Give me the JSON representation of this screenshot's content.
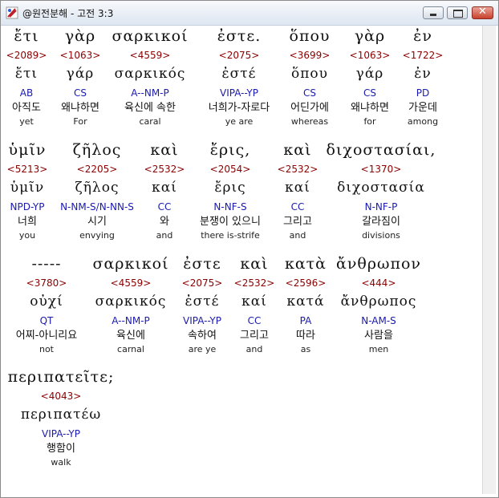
{
  "window": {
    "title": "@원전분해 - 고전 3:3",
    "minimize_label": "_",
    "maximize_label": "□",
    "close_label": "✕"
  },
  "rows": [
    {
      "words": [
        {
          "greek": "ἔτι",
          "strong": "<2089>",
          "lemma": "ἔτι",
          "code": "AB",
          "korean": "아직도",
          "english": "yet"
        },
        {
          "greek": "γὰρ",
          "strong": "<1063>",
          "lemma": "γάρ",
          "code": "CS",
          "korean": "왜냐하면",
          "english": "For"
        },
        {
          "greek": "σαρκικοί",
          "strong": "<4559>",
          "lemma": "σαρκικός",
          "code": "A--NM-P",
          "korean": "육신에 속한",
          "english": "caral"
        },
        {
          "greek": "ἐστε.",
          "strong": "<2075>",
          "lemma": "ἐστέ",
          "code": "VIPA--YP",
          "korean": "너희가-자로다",
          "english": "ye are"
        },
        {
          "greek": "ὅπου",
          "strong": "<3699>",
          "lemma": "ὅπου",
          "code": "CS",
          "korean": "어딘가에",
          "english": "whereas"
        },
        {
          "greek": "γὰρ",
          "strong": "<1063>",
          "lemma": "γάρ",
          "code": "CS",
          "korean": "왜냐하면",
          "english": "for"
        },
        {
          "greek": "ἐν",
          "strong": "<1722>",
          "lemma": "ἐν",
          "code": "PD",
          "korean": "가운데",
          "english": "among"
        }
      ]
    },
    {
      "words": [
        {
          "greek": "ὑμῖν",
          "strong": "<5213>",
          "lemma": "ὑμῖν",
          "code": "NPD-YP",
          "korean": "너희",
          "english": "you"
        },
        {
          "greek": "ζῆλος",
          "strong": "<2205>",
          "lemma": "ζῆλος",
          "code": "N-NM-S/N-NN-S",
          "korean": "시기",
          "english": "envying"
        },
        {
          "greek": "καὶ",
          "strong": "<2532>",
          "lemma": "καί",
          "code": "CC",
          "korean": "와",
          "english": "and"
        },
        {
          "greek": "ἔρις,",
          "strong": "<2054>",
          "lemma": "ἔρις",
          "code": "N-NF-S",
          "korean": "분쟁이 있으니",
          "english": "there is-strife"
        },
        {
          "greek": "καὶ",
          "strong": "<2532>",
          "lemma": "καί",
          "code": "CC",
          "korean": "그리고",
          "english": "and"
        },
        {
          "greek": "διχοστασίαι,",
          "strong": "<1370>",
          "lemma": "διχοστασία",
          "code": "N-NF-P",
          "korean": "갈라짐이",
          "english": "divisions"
        }
      ]
    },
    {
      "words": [
        {
          "greek": "-----",
          "strong": "<3780>",
          "lemma": "οὐχί",
          "code": "QT",
          "korean": "어찌-아니리요",
          "english": "not"
        },
        {
          "greek": "σαρκικοί",
          "strong": "<4559>",
          "lemma": "σαρκικός",
          "code": "A--NM-P",
          "korean": "육신에",
          "english": "carnal"
        },
        {
          "greek": "ἐστε",
          "strong": "<2075>",
          "lemma": "ἐστέ",
          "code": "VIPA--YP",
          "korean": "속하여",
          "english": "are ye"
        },
        {
          "greek": "καὶ",
          "strong": "<2532>",
          "lemma": "καί",
          "code": "CC",
          "korean": "그리고",
          "english": "and"
        },
        {
          "greek": "κατὰ",
          "strong": "<2596>",
          "lemma": "κατά",
          "code": "PA",
          "korean": "따라",
          "english": "as"
        },
        {
          "greek": "ἄνθρωπον",
          "strong": "<444>",
          "lemma": "ἄνθρωπος",
          "code": "N-AM-S",
          "korean": "사람을",
          "english": "men"
        }
      ]
    },
    {
      "words": [
        {
          "greek": "περιπατεῖτε;",
          "strong": "<4043>",
          "lemma": "περιπατέω",
          "code": "VIPA--YP",
          "korean": "행함이",
          "english": "walk"
        }
      ]
    }
  ]
}
